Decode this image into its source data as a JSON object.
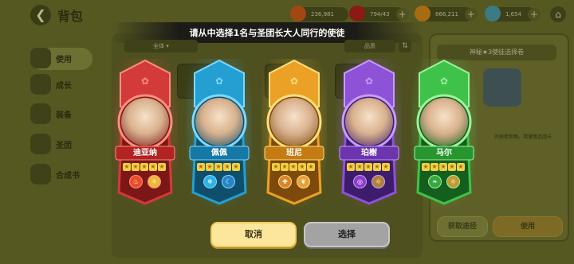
{
  "header": {
    "title": "背包",
    "back_icon": "arrow-left-icon"
  },
  "resources": [
    {
      "value": "236,981",
      "icon": "coin-icon",
      "color": "#a14712"
    },
    {
      "value": "794/43",
      "icon": "energy-icon",
      "color": "#8c1a14"
    },
    {
      "value": "866,211",
      "icon": "gold-icon",
      "color": "#a76b11"
    },
    {
      "value": "1,654",
      "icon": "gem-icon",
      "color": "#3c7b83"
    }
  ],
  "sidebar": {
    "items": [
      {
        "label": "使用",
        "icon": "use-icon",
        "active": true
      },
      {
        "label": "成长",
        "icon": "growth-icon"
      },
      {
        "label": "装备",
        "icon": "equipment-icon"
      },
      {
        "label": "圣团",
        "icon": "guild-icon"
      },
      {
        "label": "合成书",
        "icon": "crafting-book-icon"
      }
    ]
  },
  "right_panel": {
    "title": "神秘★3使徒选择卷",
    "description": "的使徒和物。请谨慎圣团卡",
    "get_path_label": "获取途径",
    "use_label": "使用"
  },
  "modal": {
    "title": "请从中选择1名与圣团长大人同行的使徒",
    "filter_label": "全体",
    "sort_label": "品质",
    "cancel_label": "取消",
    "select_label": "选择"
  },
  "characters": [
    {
      "name": "迪亚纳",
      "theme": "red",
      "frame": "#d33a3a",
      "light": "#ff8f7e",
      "dark": "#7c1717",
      "plate": "#b22323",
      "skills": [
        "flame-icon",
        "sun-icon"
      ],
      "skill_colors": [
        "#e84d2c",
        "#efb63a"
      ],
      "stars": 5
    },
    {
      "name": "佩佩",
      "theme": "blue",
      "frame": "#239fd2",
      "light": "#7fd8ff",
      "dark": "#0f4f6c",
      "plate": "#1679a5",
      "skills": [
        "snowflake-icon",
        "moon-icon"
      ],
      "skill_colors": [
        "#2fb2e4",
        "#2a85c7"
      ],
      "stars": 5
    },
    {
      "name": "班尼",
      "theme": "orange",
      "frame": "#eba126",
      "light": "#ffe07e",
      "dark": "#7e4a0c",
      "plate": "#c57b13",
      "skills": [
        "wrench-icon",
        "wings-icon"
      ],
      "skill_colors": [
        "#d9852a",
        "#e6a23a"
      ],
      "stars": 5
    },
    {
      "name": "珀榭",
      "theme": "purple",
      "frame": "#8d52d6",
      "light": "#c69cff",
      "dark": "#3e1c6c",
      "plate": "#6c35ae",
      "skills": [
        "swirl-icon",
        "sun-icon"
      ],
      "skill_colors": [
        "#8d3ecb",
        "#b08137"
      ],
      "stars": 5
    },
    {
      "name": "马尔",
      "theme": "green",
      "frame": "#3fc24a",
      "light": "#9ff29c",
      "dark": "#155f1e",
      "plate": "#27962f",
      "skills": [
        "leaf-icon",
        "sun-icon"
      ],
      "skill_colors": [
        "#37a83f",
        "#c39a2f"
      ],
      "stars": 5
    }
  ]
}
